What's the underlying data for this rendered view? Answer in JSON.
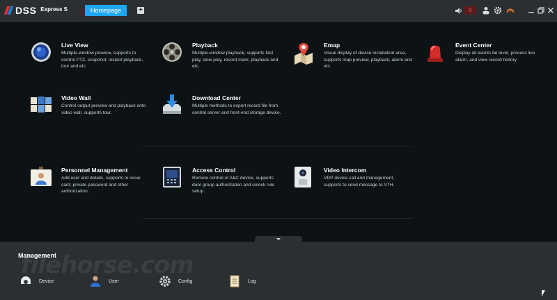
{
  "app": {
    "logo_text": "DSS",
    "logo_sub": "Express S",
    "home_tab": "Homepage",
    "add_tab": "+",
    "alarm_count": "0"
  },
  "colors": {
    "accent": "#1ea7f0",
    "background": "#0d1214",
    "topbar": "#2b2f32",
    "management_bar": "#2a2f32"
  },
  "modules": [
    {
      "title": "Live View",
      "desc": "Multiple-window preview, supports to control PTZ, snapshot, instant playback, tour and etc.",
      "icon": "live-view-icon"
    },
    {
      "title": "Playback",
      "desc": "Multiple-window playback, supports fast play, slow play, record mark, playback and etc.",
      "icon": "playback-icon"
    },
    {
      "title": "Emap",
      "desc": "Visual display of device installation area, supports map preview, playback, alarm and etc.",
      "icon": "emap-icon"
    },
    {
      "title": "Event Center",
      "desc": "Display all events be level, process live alarm, and view record history.",
      "icon": "event-center-icon"
    },
    {
      "title": "Video Wall",
      "desc": "Control output preview and playback onto video wall, supports tour.",
      "icon": "video-wall-icon"
    },
    {
      "title": "Download Center",
      "desc": "Multiple methods to export record file from central server and front-end storage device.",
      "icon": "download-center-icon"
    },
    {
      "title": "Personnel Management",
      "desc": "Add user and details, supports to issue card, private password and other authorization.",
      "icon": "personnel-icon"
    },
    {
      "title": "Access Control",
      "desc": "Remote control of A&C device, supports door group authorization and unlock rule setup.",
      "icon": "access-control-icon"
    },
    {
      "title": "Video Intercom",
      "desc": "VDP device call and management, supports to send message to VTH.",
      "icon": "video-intercom-icon"
    }
  ],
  "management": {
    "title": "Management",
    "items": [
      {
        "label": "Device",
        "icon": "device-icon"
      },
      {
        "label": "User",
        "icon": "user-icon"
      },
      {
        "label": "Config",
        "icon": "config-icon"
      },
      {
        "label": "Log",
        "icon": "log-icon"
      }
    ],
    "watermark": "filehorse.com"
  }
}
